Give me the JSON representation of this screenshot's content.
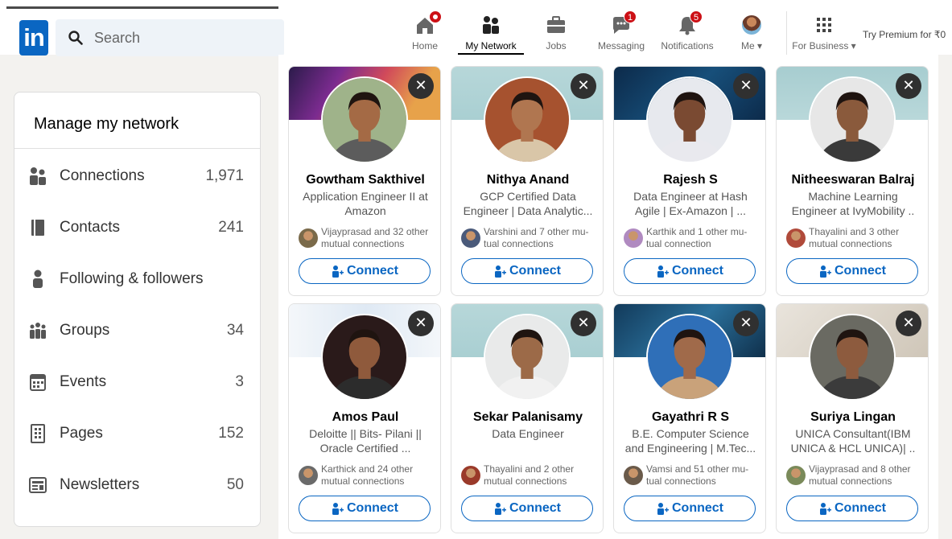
{
  "search": {
    "placeholder": "Search"
  },
  "logo": {
    "text": "in"
  },
  "nav": {
    "home": "Home",
    "network": "My Network",
    "jobs": "Jobs",
    "messaging": "Messaging",
    "messaging_badge": "1",
    "notifications": "Notifications",
    "notifications_badge": "5",
    "me": "Me",
    "business": "For Business",
    "premium": "Try Premium for ₹0"
  },
  "sidebar": {
    "title": "Manage my network",
    "items": [
      {
        "label": "Connections",
        "count": "1,971",
        "icon": "people-icon"
      },
      {
        "label": "Contacts",
        "count": "241",
        "icon": "contact-book-icon"
      },
      {
        "label": "Following & followers",
        "count": "",
        "icon": "person-icon"
      },
      {
        "label": "Groups",
        "count": "34",
        "icon": "groups-icon"
      },
      {
        "label": "Events",
        "count": "3",
        "icon": "calendar-icon"
      },
      {
        "label": "Pages",
        "count": "152",
        "icon": "building-icon"
      },
      {
        "label": "Newsletters",
        "count": "50",
        "icon": "newspaper-icon"
      }
    ]
  },
  "connect_label": "Connect",
  "cards": [
    {
      "name": "Gowtham Sakthivel",
      "headline": "Application Engineer II at Amazon",
      "mutual": "Vijayprasad and 32 other mutual connections"
    },
    {
      "name": "Nithya Anand",
      "headline": "GCP Certified Data Engineer | Data Analytic...",
      "mutual": "Varshini and 7 other mu-tual connections"
    },
    {
      "name": "Rajesh S",
      "headline": "Data Engineer at Hash Agile | Ex-Amazon | ...",
      "mutual": "Karthik and 1 other mu-tual connection"
    },
    {
      "name": "Nitheeswaran Balraj",
      "headline": "Machine Learning Engineer at IvyMobility ..",
      "mutual": "Thayalini and 3 other mutual connections"
    },
    {
      "name": "Amos Paul",
      "headline": "Deloitte || Bits- Pilani || Oracle Certified ...",
      "mutual": "Karthick and 24 other mutual connections"
    },
    {
      "name": "Sekar Palanisamy",
      "headline": "Data Engineer",
      "mutual": "Thayalini and 2 other mutual connections"
    },
    {
      "name": "Gayathri R S",
      "headline": "B.E. Computer Science and Engineering | M.Tec...",
      "mutual": "Vamsi and 51 other mu-tual connections"
    },
    {
      "name": "Suriya Lingan",
      "headline": "UNICA Consultant(IBM UNICA & HCL UNICA)| ..",
      "mutual": "Vijayprasad and 8 other mutual connections"
    }
  ],
  "colors": {
    "brand": "#0a66c2",
    "badge": "#cc1016"
  }
}
